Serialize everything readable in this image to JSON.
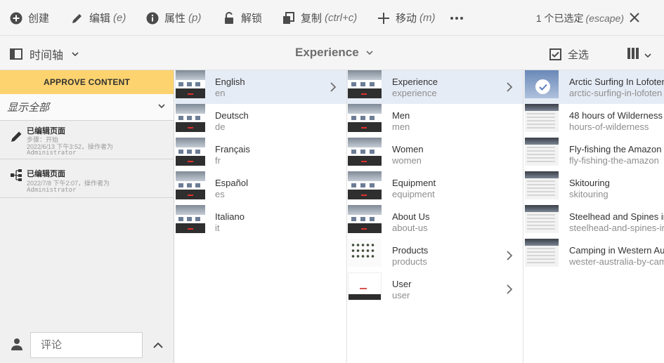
{
  "actions": {
    "create": {
      "label": "创建",
      "icon": "add-circle-icon"
    },
    "edit": {
      "label": "编辑",
      "shortcut": "(e)",
      "icon": "pencil-icon"
    },
    "properties": {
      "label": "属性",
      "shortcut": "(p)",
      "icon": "info-icon"
    },
    "unlock": {
      "label": "解锁",
      "icon": "unlock-icon"
    },
    "copy": {
      "label": "复制",
      "shortcut": "(ctrl+c)",
      "icon": "copy-icon"
    },
    "move": {
      "label": "移动",
      "shortcut": "(m)",
      "icon": "move-icon"
    },
    "more": {
      "icon": "more-icon"
    },
    "selection": {
      "count_label": "1 个已选定",
      "shortcut": "(escape)"
    }
  },
  "subbar": {
    "rail_label": "时间轴",
    "breadcrumb": "Experience",
    "select_all": "全选"
  },
  "rail": {
    "approve": "APPROVE CONTENT",
    "filter": "显示全部",
    "events": [
      {
        "title": "已编辑页面",
        "detail": "步骤：开始",
        "time": "2022/6/13 下午3:52，操作者为",
        "user": "Administrator",
        "icon": "pencil-icon"
      },
      {
        "title": "已编辑页面",
        "detail": "",
        "time": "2022/7/8 下午2:07，操作者为",
        "user": "Administrator",
        "icon": "workflow-icon"
      }
    ],
    "comment_placeholder": "评论"
  },
  "columns": {
    "col1": [
      {
        "title": "English",
        "name": "en"
      },
      {
        "title": "Deutsch",
        "name": "de"
      },
      {
        "title": "Français",
        "name": "fr"
      },
      {
        "title": "Español",
        "name": "es"
      },
      {
        "title": "Italiano",
        "name": "it"
      }
    ],
    "col2": [
      {
        "title": "Experience",
        "name": "experience"
      },
      {
        "title": "Men",
        "name": "men"
      },
      {
        "title": "Women",
        "name": "women"
      },
      {
        "title": "Equipment",
        "name": "equipment"
      },
      {
        "title": "About Us",
        "name": "about-us"
      },
      {
        "title": "Products",
        "name": "products"
      },
      {
        "title": "User",
        "name": "user"
      }
    ],
    "col3": [
      {
        "title": "Arctic Surfing In Lofoten",
        "name": "arctic-surfing-in-lofoten"
      },
      {
        "title": "48 hours of Wilderness",
        "name": "hours-of-wilderness"
      },
      {
        "title": "Fly-fishing the Amazon",
        "name": "fly-fishing-the-amazon"
      },
      {
        "title": "Skitouring",
        "name": "skitouring"
      },
      {
        "title": "Steelhead and Spines in A",
        "name": "steelhead-and-spines-in-a"
      },
      {
        "title": "Camping in Western Austr",
        "name": "wester-australia-by-camp"
      }
    ]
  },
  "colors": {
    "approve_bar": "#fcd36e",
    "active_row": "#e6ecf5",
    "accent_red": "#e0312b"
  }
}
